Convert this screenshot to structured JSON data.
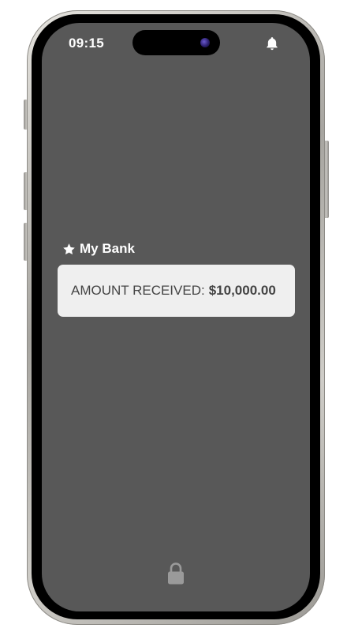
{
  "status_bar": {
    "time": "09:15",
    "notification_icon": "bell-icon"
  },
  "notification": {
    "app_icon": "star-icon",
    "app_name": "My Bank",
    "label": "AMOUNT RECEIVED:",
    "amount": "$10,000.00"
  },
  "lock_screen": {
    "lock_icon": "lock-icon"
  },
  "colors": {
    "screen_background": "#585858",
    "card_background": "#efefef",
    "text_light": "#ffffff",
    "text_dark": "#444444"
  }
}
